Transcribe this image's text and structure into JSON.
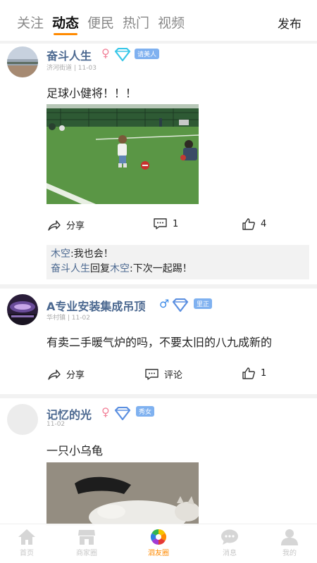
{
  "tabs": [
    "关注",
    "动态",
    "便民",
    "热门",
    "视频"
  ],
  "publish_label": "发布",
  "posts": [
    {
      "user": "奋斗人生",
      "gender": "♀",
      "badge": "请美人",
      "location": "济河街道",
      "date": "11-03",
      "text": "足球小健将！！！",
      "actions": {
        "share": "分享",
        "comments": "1",
        "likes": "4"
      },
      "comment_list": [
        {
          "author": "木空",
          "text": ":我也会！"
        },
        {
          "author": "奋斗人生",
          "reply_word": "回复",
          "reply_to": "木空",
          "text": ":下次一起踢！"
        }
      ]
    },
    {
      "user": "A专业安装集成吊顶",
      "gender": "♂",
      "badge": "里正",
      "location": "华村镇",
      "date": "11-02",
      "text": "有卖二手暖气炉的吗，不要太旧的八九成新的",
      "actions": {
        "share": "分享",
        "comments": "评论",
        "likes": "1"
      }
    },
    {
      "user": "记忆的光",
      "gender": "♀",
      "badge": "秀女",
      "date": "11-02",
      "text": "一只小乌龟"
    }
  ],
  "bottom_nav": [
    {
      "label": "首页",
      "icon": "home-icon"
    },
    {
      "label": "商家圈",
      "icon": "shop-icon"
    },
    {
      "label": "泗友圈",
      "icon": "camera-aperture-icon",
      "active": true
    },
    {
      "label": "消息",
      "icon": "message-icon"
    },
    {
      "label": "我的",
      "icon": "user-icon"
    }
  ],
  "colors": {
    "accent": "#ff8a00",
    "username": "#4b6890",
    "badge": "#7fb1f0",
    "female": "#f2839a",
    "male": "#3d8be8"
  }
}
